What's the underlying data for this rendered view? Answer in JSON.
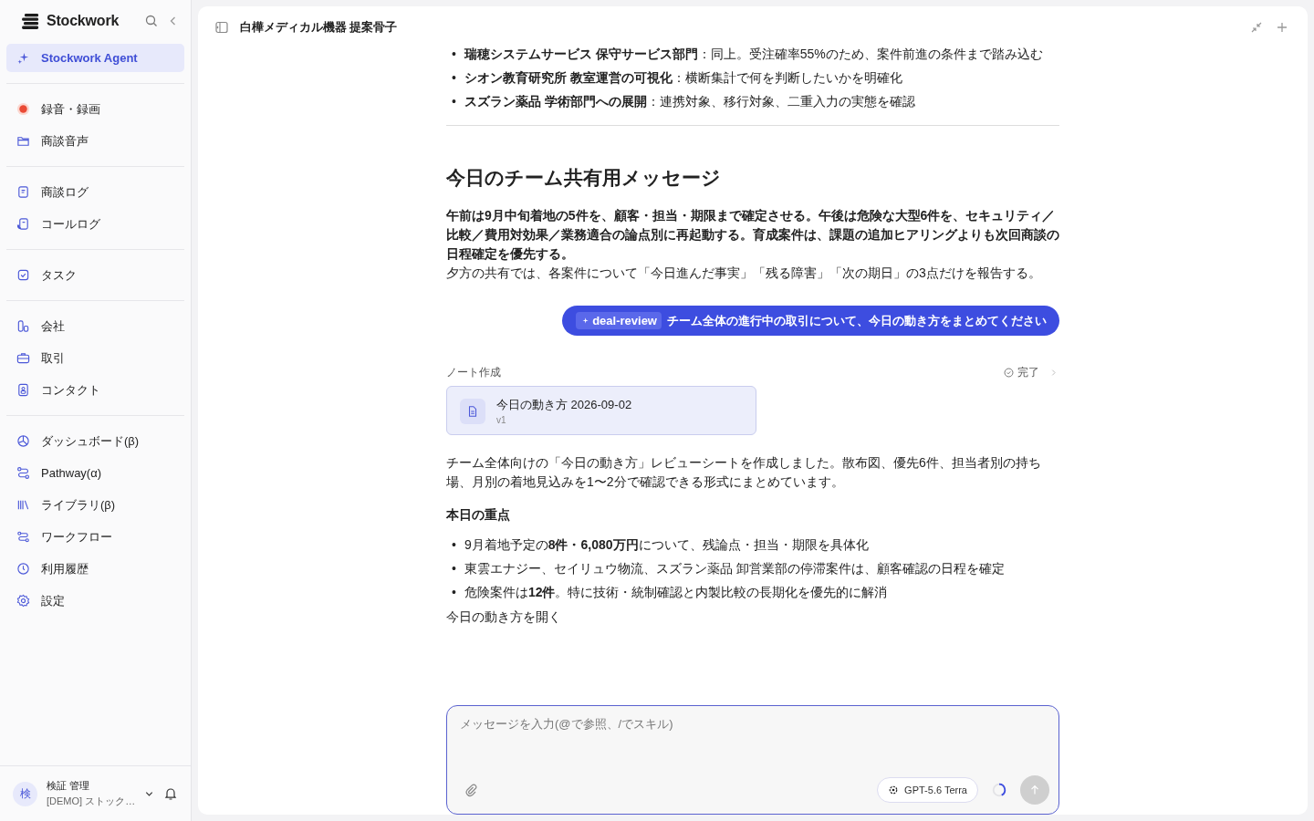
{
  "sidebar": {
    "brand": "Stockwork",
    "groups": [
      [
        {
          "label": "Stockwork Agent",
          "selected": true
        }
      ],
      [
        {
          "label": "録音・録画",
          "selected": false
        },
        {
          "label": "商談音声",
          "selected": false
        }
      ],
      [
        {
          "label": "商談ログ",
          "selected": false
        },
        {
          "label": "コールログ",
          "selected": false
        }
      ],
      [
        {
          "label": "タスク",
          "selected": false
        }
      ],
      [
        {
          "label": "会社",
          "selected": false
        },
        {
          "label": "取引",
          "selected": false
        },
        {
          "label": "コンタクト",
          "selected": false
        }
      ],
      [
        {
          "label": "ダッシュボード(β)",
          "selected": false
        },
        {
          "label": "Pathway(α)",
          "selected": false
        },
        {
          "label": "ライブラリ(β)",
          "selected": false
        },
        {
          "label": "ワークフロー",
          "selected": false
        },
        {
          "label": "利用履歴",
          "selected": false
        },
        {
          "label": "設定",
          "selected": false
        }
      ]
    ],
    "user": {
      "avatar": "検",
      "name": "検証 管理",
      "org": "[DEMO] ストック…"
    }
  },
  "header": {
    "title": "白樺メディカル機器 提案骨子"
  },
  "messages": [
    {
      "kind": "bullets",
      "marker": "•",
      "items": [
        "**瑞穂システムサービス 保守サービス部門**：同上。受注確率55%のため、案件前進の条件まで踏み込む",
        "**シオン教育研究所 教室運営の可視化**：横断集計で何を判断したいかを明確化",
        "**スズラン薬品 学術部門への展開**：連携対象、移行対象、二重入力の実態を確認"
      ]
    },
    {
      "kind": "divider"
    },
    {
      "kind": "heading",
      "text": "今日のチーム共有用メッセージ"
    },
    {
      "kind": "strong",
      "text": "午前は9月中旬着地の5件を、顧客・担当・期限まで確定させる。午後は危険な大型6件を、セキュリティ／比較／費用対効果／業務適合の論点別に再起動する。育成案件は、課題の追加ヒアリングよりも次回商談の日程確定を優先する。"
    },
    {
      "kind": "paragraph",
      "text": "夕方の共有では、各案件について「今日進んだ事実」「残る障害」「次の期日」の3点だけを報告する。"
    },
    {
      "kind": "user",
      "skill": "deal-review",
      "text": "チーム全体の進行中の取引について、今日の動き方をまとめてください"
    },
    {
      "kind": "tool",
      "label": "ノート作成",
      "status": "完了",
      "doc_title": "今日の動き方 2026-09-02",
      "doc_version": "v1"
    },
    {
      "kind": "paragraph",
      "text": "チーム全体向けの「今日の動き方」レビューシートを作成しました。散布図、優先6件、担当者別の持ち場、月別の着地見込みを1〜2分で確認できる形式にまとめています。"
    },
    {
      "kind": "subheading",
      "text": "本日の重点"
    },
    {
      "kind": "bullets",
      "marker": "•",
      "items": [
        "9月着地予定の**8件・6,080万円**について、残論点・担当・期限を具体化",
        "東雲エナジー、セイリュウ物流、スズラン薬品 卸営業部の停滞案件は、顧客確認の日程を確定",
        "危険案件は**12件**。特に技術・統制確認と内製比較の長期化を優先的に解消"
      ]
    },
    {
      "kind": "link",
      "text": "今日の動き方を開く"
    }
  ],
  "composer": {
    "placeholder": "メッセージを入力(@で参照、/でスキル)",
    "model": "GPT-5.6 Terra"
  }
}
